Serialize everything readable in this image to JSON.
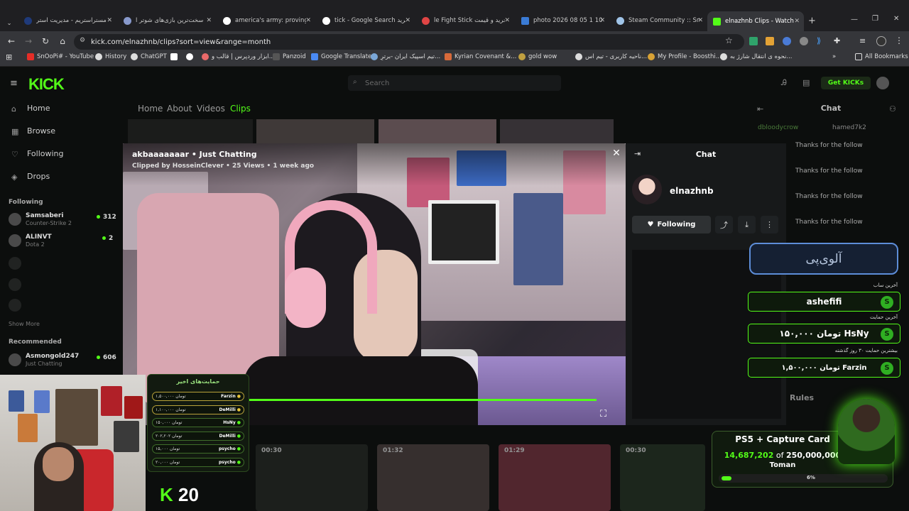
{
  "browser": {
    "tabs": [
      {
        "title": "مستراستریم - مدیریت استر",
        "color": "#1f3a7a"
      },
      {
        "title": "سخت‌ترین بازی‌های شوتر ا",
        "color": "#8899cc"
      },
      {
        "title": "america's army: proving g",
        "color": "#ffffff"
      },
      {
        "title": "tick - Google Search خرید",
        "color": "#ffffff"
      },
      {
        "title": "le Fight Stick خرید و قیمت",
        "color": "#e04545"
      },
      {
        "title": "photo 2026 08 05 1 10 19",
        "color": "#3a7bd5"
      },
      {
        "title": "Steam Community :: SnO",
        "color": "#a0c4e8"
      },
      {
        "title": "elnazhnb Clips - Watch L",
        "color": "#53fc18"
      }
    ],
    "url": "kick.com/elnazhnb/clips?sort=view&range=month",
    "bookmarks": [
      "SnOoPi# - YouTube",
      "History",
      "ChatGPT",
      "ابزار وردپرس | قالب و...",
      "Panzoid",
      "Google Translate",
      "تیم اسپیک ایران -برترِ...",
      "Kyrian Covenant &...",
      "gold wow",
      "ناحیه کاربری - تیم اس...",
      "My Profile - Boosthi...",
      "نحوه ی انتقال شارژ به...",
      "All Bookmarks"
    ]
  },
  "kick": {
    "search_placeholder": "Search",
    "get_kicks": "Get KICKs",
    "sidebar": {
      "nav": [
        "Home",
        "Browse",
        "Following",
        "Drops"
      ],
      "following_header": "Following",
      "following": [
        {
          "name": "Samsaberi",
          "game": "Counter-Strike 2",
          "count": "312"
        },
        {
          "name": "ALINVT",
          "game": "Dota 2",
          "count": "2"
        }
      ],
      "show_more": "Show More",
      "recommended_header": "Recommended",
      "recommended": [
        {
          "name": "Asmongold247",
          "game": "Just Chatting",
          "count": "606"
        }
      ]
    },
    "channel_nav": [
      "Home",
      "About",
      "Videos",
      "Clips"
    ],
    "right_chat": {
      "title": "Chat",
      "users": [
        "dbloodycrow",
        "hamed7k2"
      ],
      "lines": [
        "Thanks for the follow",
        "Thanks for the follow",
        "Thanks for the follow",
        "Thanks for the follow"
      ],
      "rules": "Rules"
    }
  },
  "clip_modal": {
    "title": "akbaaaaaaar • Just Chatting",
    "subtitle": "Clipped by HosseinClever • 25 Views • 1 week ago",
    "panel_title": "Chat",
    "channel": "elnazhnb",
    "follow_label": "Following"
  },
  "overlay": {
    "brand": "آلوی‌پی",
    "last_sub_label": "آخرین ساب",
    "last_sub": "ashefifi",
    "last_donation_label": "آخرین حمایت",
    "last_donation": "۱۵۰,۰۰۰ تومان HsNy",
    "top_donation_label": "بیشترین حمایت ۳۰ روز گذشته",
    "top_donation": "۱,۵۰۰,۰۰۰ تومان Farzin",
    "goal": {
      "title": "PS5 + Capture Card",
      "current": "14,687,202",
      "of": "of",
      "target": "250,000,000",
      "unit": "Toman",
      "percent_label": "6%",
      "progress": 0.06
    },
    "donations_title": "حمایت‌های اخیر",
    "donations": [
      {
        "name": "Farzin",
        "amount": "۱,۵۰۰,۰۰۰ تومان"
      },
      {
        "name": "DeMilli",
        "amount": "۱,۱۰۰,۰۰۰ تومان"
      },
      {
        "name": "HsNy",
        "amount": "۱۵۰,۰۰۰ تومان"
      },
      {
        "name": "DeMilli",
        "amount": "۲۰۲,۲۰۲ تومان"
      },
      {
        "name": "psycho",
        "amount": "۱۵,۰۰۰ تومان"
      },
      {
        "name": "psycho",
        "amount": "۲۰,۰۰۰ تومان"
      }
    ],
    "kick_badge": "K",
    "viewer_count": "20"
  },
  "thumbnails": [
    "00:30",
    "01:32",
    "01:29",
    "00:30"
  ]
}
